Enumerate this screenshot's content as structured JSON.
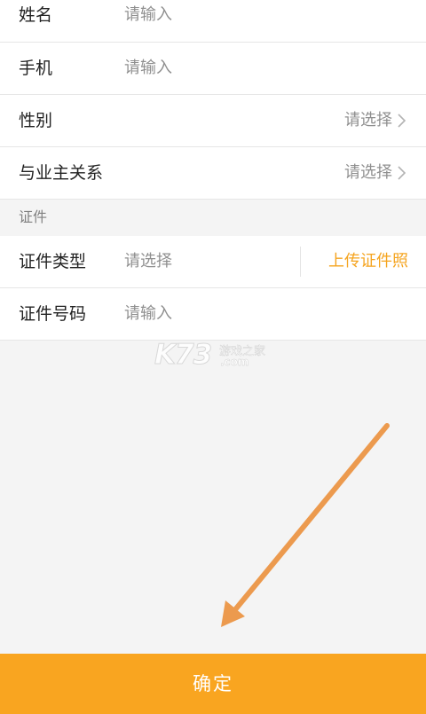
{
  "form": {
    "name": {
      "label": "姓名",
      "placeholder": "请输入"
    },
    "phone": {
      "label": "手机",
      "placeholder": "请输入"
    },
    "gender": {
      "label": "性别",
      "placeholder": "请选择"
    },
    "relation": {
      "label": "与业主关系",
      "placeholder": "请选择"
    }
  },
  "certificate_section": {
    "header": "证件",
    "type": {
      "label": "证件类型",
      "placeholder": "请选择",
      "upload_label": "上传证件照"
    },
    "number": {
      "label": "证件号码",
      "placeholder": "请输入"
    }
  },
  "watermark": {
    "logo": "K73",
    "site_cn": "游戏之家",
    "domain": ".com"
  },
  "confirm_button": {
    "label": "确定"
  },
  "colors": {
    "accent": "#f9a520",
    "upload_text": "#f5a41f",
    "arrow": "#ec9a4e",
    "background": "#f4f4f4"
  },
  "icons": {
    "chevron": "chevron-right-icon",
    "arrow": "arrow-down-left-icon"
  }
}
